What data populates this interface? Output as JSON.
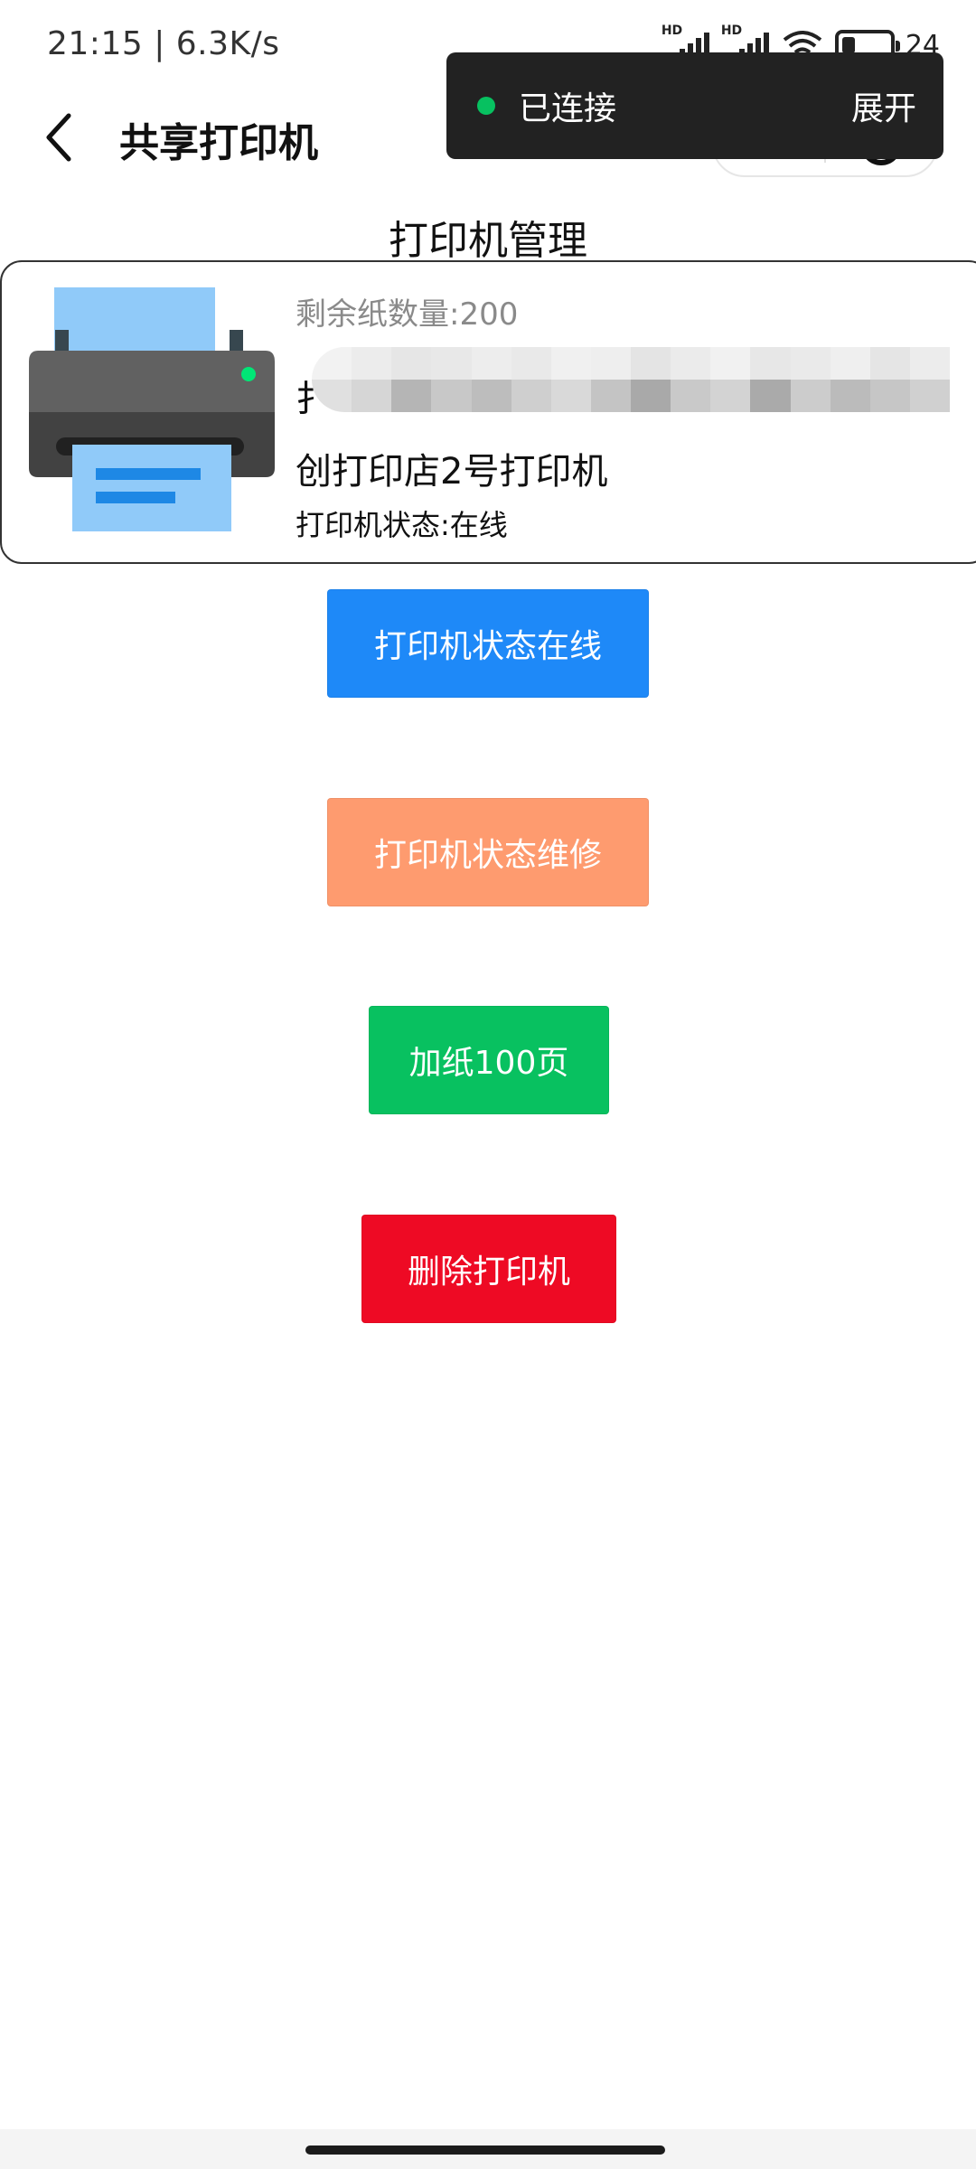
{
  "status_bar": {
    "time": "21:15 | 6.3K/s",
    "signal_1_label": "HD",
    "signal_2_label": "HD",
    "battery": "24"
  },
  "nav": {
    "title": "共享打印机",
    "back_icon": "chevron-left-icon",
    "more_icon": "more-dots-icon",
    "close_icon": "target-circle-icon"
  },
  "toast": {
    "status": "已连接",
    "expand_label": "展开",
    "dot_color": "#07c160"
  },
  "page": {
    "heading": "打印机管理"
  },
  "printer_card": {
    "paper_remaining": "剩余纸数量:200",
    "name_prefix": "扌",
    "name_line2": "创打印店2号打印机",
    "status": "打印机状态:在线",
    "icon": "printer-icon"
  },
  "actions": {
    "online": {
      "label": "打印机状态在线",
      "color": "#1e89f8"
    },
    "repair": {
      "label": "打印机状态维修",
      "color": "#fe9b6f"
    },
    "add_paper": {
      "label": "加纸100页",
      "color": "#08c160"
    },
    "delete": {
      "label": "删除打印机",
      "color": "#ee0a24"
    }
  }
}
